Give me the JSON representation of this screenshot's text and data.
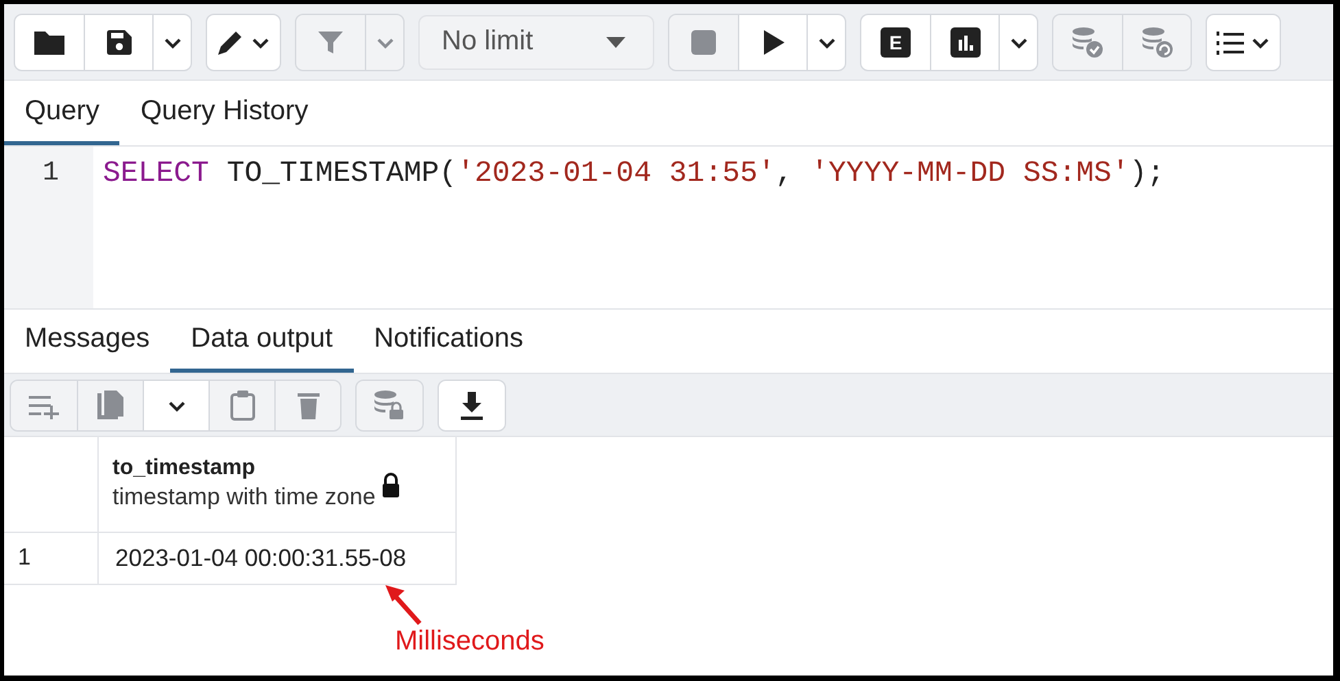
{
  "toolbar": {
    "groups": [
      {
        "buttons": [
          {
            "kind": "folder",
            "disabled": false
          },
          {
            "kind": "save",
            "disabled": false
          },
          {
            "kind": "caret",
            "disabled": false
          }
        ]
      },
      {
        "buttons": [
          {
            "kind": "edit",
            "disabled": false
          }
        ]
      },
      {
        "buttons": [
          {
            "kind": "filter",
            "disabled": true
          },
          {
            "kind": "caret",
            "disabled": true
          }
        ]
      },
      {
        "select": {
          "value": "No limit"
        }
      },
      {
        "buttons": [
          {
            "kind": "stop",
            "disabled": true
          },
          {
            "kind": "play",
            "disabled": false
          },
          {
            "kind": "caret",
            "disabled": false
          }
        ]
      },
      {
        "buttons": [
          {
            "kind": "explain",
            "label": "E",
            "disabled": false
          },
          {
            "kind": "chart",
            "disabled": false
          },
          {
            "kind": "caret",
            "disabled": false
          }
        ]
      },
      {
        "buttons": [
          {
            "kind": "commit",
            "disabled": true
          },
          {
            "kind": "rollback",
            "disabled": true
          }
        ]
      },
      {
        "buttons": [
          {
            "kind": "list",
            "disabled": false
          }
        ]
      }
    ]
  },
  "editor_tabs": [
    {
      "label": "Query",
      "selected": true
    },
    {
      "label": "Query History",
      "selected": false
    }
  ],
  "editor": {
    "lines": [
      {
        "number": "1",
        "tokens": [
          {
            "text": "SELECT",
            "kind": "keyword"
          },
          {
            "text": " TO_TIMESTAMP(",
            "kind": "plain"
          },
          {
            "text": "'2023-01-04 31:55'",
            "kind": "string"
          },
          {
            "text": ", ",
            "kind": "plain"
          },
          {
            "text": "'YYYY-MM-DD SS:MS'",
            "kind": "string"
          },
          {
            "text": ");",
            "kind": "plain"
          }
        ]
      }
    ]
  },
  "output_tabs": [
    {
      "label": "Messages",
      "selected": false
    },
    {
      "label": "Data output",
      "selected": true
    },
    {
      "label": "Notifications",
      "selected": false
    }
  ],
  "output_toolbar": {
    "groups": [
      {
        "buttons": [
          {
            "kind": "addrow",
            "disabled": true
          },
          {
            "kind": "copy",
            "disabled": true
          },
          {
            "kind": "caret",
            "disabled": false
          },
          {
            "kind": "paste",
            "disabled": true
          },
          {
            "kind": "delete",
            "disabled": true
          }
        ]
      },
      {
        "buttons": [
          {
            "kind": "dblock",
            "disabled": true
          }
        ]
      },
      {
        "buttons": [
          {
            "kind": "download",
            "disabled": false
          }
        ]
      }
    ]
  },
  "table": {
    "columns": [
      {
        "name": "to_timestamp",
        "type": "timestamp with time zone"
      }
    ],
    "rows": [
      {
        "number": "1",
        "cells": [
          "2023-01-04 00:00:31.55-08"
        ]
      }
    ]
  },
  "annotation": {
    "text": "Milliseconds"
  }
}
